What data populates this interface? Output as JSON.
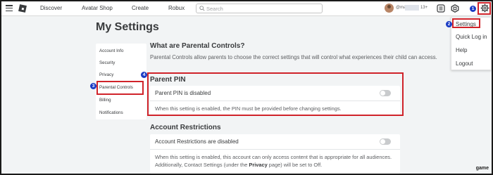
{
  "nav": {
    "links": [
      "Discover",
      "Avatar Shop",
      "Create",
      "Robux"
    ],
    "search_placeholder": "Search",
    "username": "@ma",
    "age": "13+",
    "age2": "13+"
  },
  "dropdown": {
    "items": [
      "Settings",
      "Quick Log in",
      "Help",
      "Logout"
    ]
  },
  "callouts": [
    "1",
    "2",
    "3",
    "4"
  ],
  "page": {
    "title": "My Settings",
    "leftnav": [
      "Account Info",
      "Security",
      "Privacy",
      "Parental Controls",
      "Billing",
      "Notifications"
    ]
  },
  "parental": {
    "heading": "What are Parental Controls?",
    "description": "Parental Controls allow parents to choose the correct settings that will control what experiences their child can access."
  },
  "pin": {
    "heading": "Parent PIN",
    "status": "Parent PIN is disabled",
    "description": "When this setting is enabled, the PIN must be provided before changing settings."
  },
  "restrictions": {
    "heading": "Account Restrictions",
    "status": "Account Restrictions are disabled",
    "desc_part1": "When this setting is enabled, this account can only access content that is appropriate for all audiences. Additionally, Contact Settings (under the ",
    "desc_bold": "Privacy",
    "desc_part2": " page) will be set to Off."
  },
  "watermark": "game",
  "colors": {
    "callout": "#1a3bc4",
    "highlight": "#d0232a",
    "toggle_off": "#c9cbcd"
  }
}
